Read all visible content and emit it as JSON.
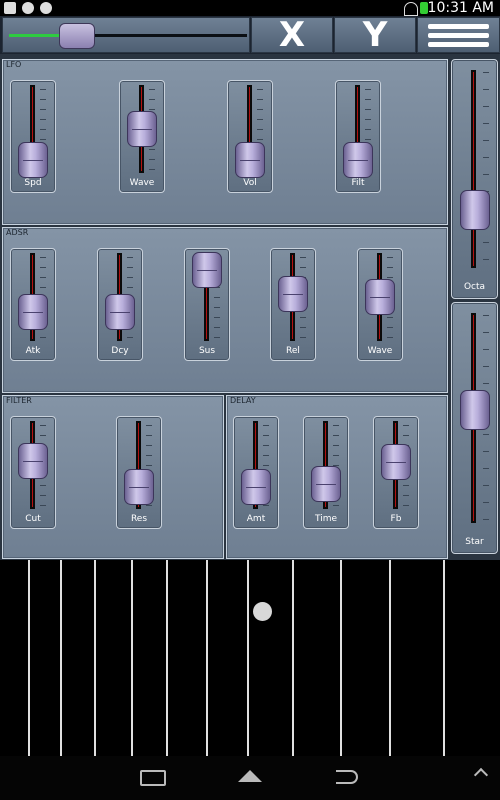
{
  "status": {
    "time": "10:31 AM"
  },
  "toolbar": {
    "x_label": "X",
    "y_label": "Y"
  },
  "sections": {
    "lfo": {
      "label": "LFO",
      "sliders": [
        {
          "label": "Spd",
          "value": 0.05
        },
        {
          "label": "Wave",
          "value": 0.55
        },
        {
          "label": "Vol",
          "value": 0.05
        },
        {
          "label": "Filt",
          "value": 0.05
        }
      ]
    },
    "adsr": {
      "label": "ADSR",
      "sliders": [
        {
          "label": "Atk",
          "value": 0.3
        },
        {
          "label": "Dcy",
          "value": 0.3
        },
        {
          "label": "Sus",
          "value": 0.98
        },
        {
          "label": "Rel",
          "value": 0.6
        },
        {
          "label": "Wave",
          "value": 0.55
        }
      ]
    },
    "filter": {
      "label": "FILTER",
      "sliders": [
        {
          "label": "Cut",
          "value": 0.62
        },
        {
          "label": "Res",
          "value": 0.2
        }
      ]
    },
    "delay": {
      "label": "DELAY",
      "sliders": [
        {
          "label": "Amt",
          "value": 0.2
        },
        {
          "label": "Time",
          "value": 0.25
        },
        {
          "label": "Fb",
          "value": 0.6
        }
      ]
    },
    "side": {
      "sliders": [
        {
          "label": "Octa",
          "value": 0.25
        },
        {
          "label": "Star",
          "value": 0.55
        }
      ]
    }
  },
  "master": {
    "value": 0.22
  },
  "icons": {
    "wifi": "wifi-icon",
    "battery": "battery-icon",
    "menu": "menu-icon"
  }
}
